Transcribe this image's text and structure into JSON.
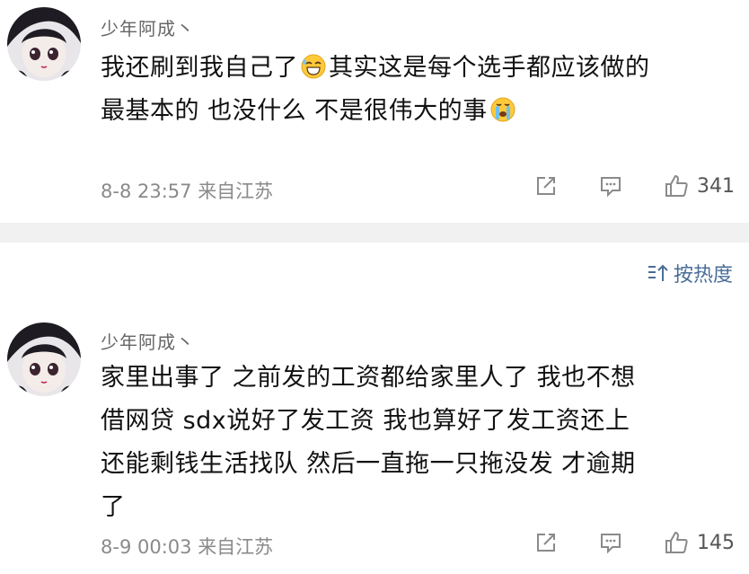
{
  "comments": [
    {
      "username": "少年阿成丶",
      "lines": [
        "我还刷到我自己了",
        "其实这是每个选手都应该做的",
        "最基本的 也没什么 不是很伟大的事"
      ],
      "emoji1": "grin-sweat-emoji",
      "emoji2": "crying-emoji",
      "time": "8-8 23:57",
      "location": "来自江苏",
      "likes": "341"
    },
    {
      "username": "少年阿成丶",
      "lines": [
        "家里出事了 之前发的工资都给家里人了 我也不想",
        "借网贷 sdx说好了发工资 我也算好了发工资还上",
        "还能剩钱生活找队 然后一直拖一只拖没发 才逾期",
        "了"
      ],
      "time": "8-9 00:03",
      "location": "来自江苏",
      "likes": "145"
    }
  ],
  "sort": {
    "label": "按热度",
    "icon": "sort-icon"
  },
  "colors": {
    "link": "#4a6d96",
    "meta": "#8a8a8a",
    "divider": "#f1f1f1"
  }
}
